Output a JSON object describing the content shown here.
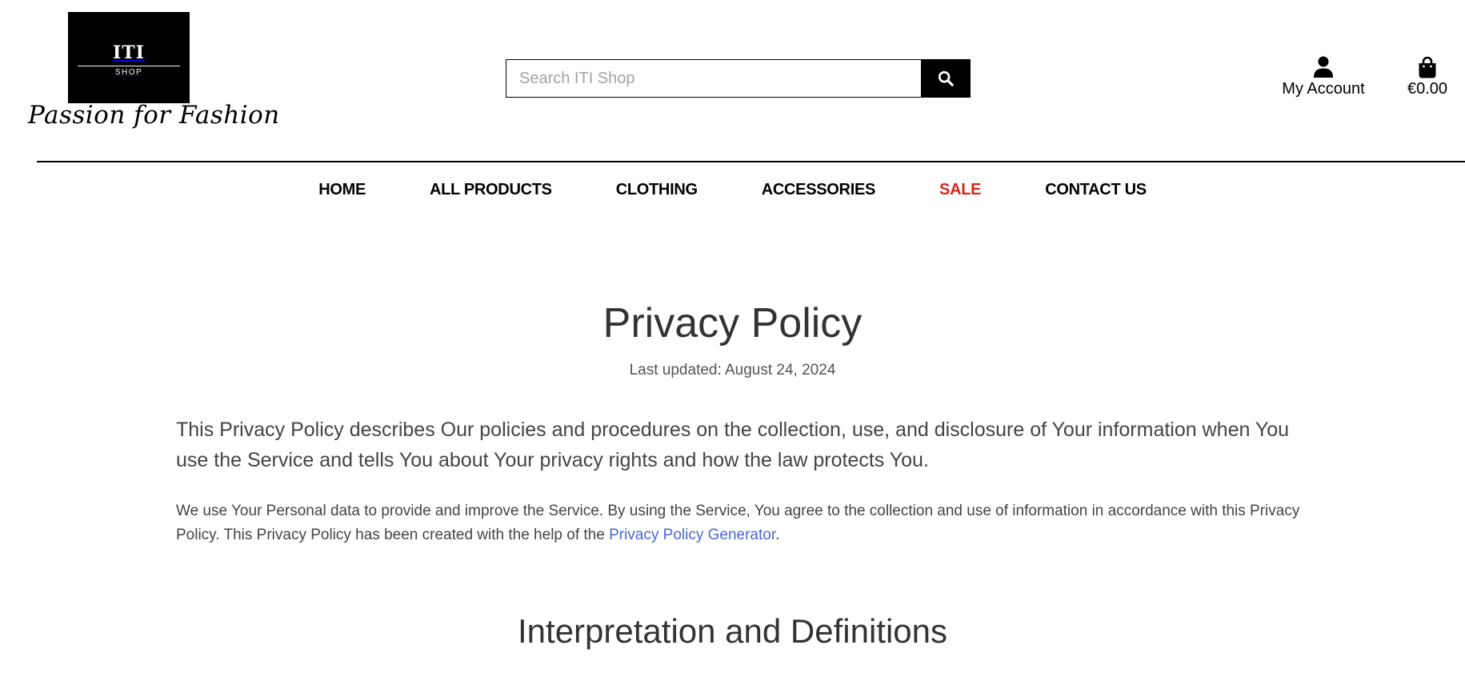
{
  "header": {
    "logo": {
      "title": "ITI",
      "subtitle": "SHOP",
      "tagline": "Passion for Fashion"
    },
    "search": {
      "placeholder": "Search ITI Shop",
      "value": ""
    },
    "account_label": "My Account",
    "cart_total": "€0.00"
  },
  "nav": {
    "items": [
      {
        "label": "HOME"
      },
      {
        "label": "ALL PRODUCTS"
      },
      {
        "label": "CLOTHING"
      },
      {
        "label": "ACCESSORIES"
      },
      {
        "label": "SALE",
        "color": "#d7261e"
      },
      {
        "label": "CONTACT US"
      }
    ]
  },
  "main": {
    "title": "Privacy Policy",
    "last_updated": "Last updated: August 24, 2024",
    "intro": "This Privacy Policy describes Our policies and procedures on the collection, use, and disclosure of Your information when You use the Service and tells You about Your privacy rights and how the law protects You.",
    "para_before_link": "We use Your Personal data to provide and improve the Service. By using the Service, You agree to the collection and use of information in accordance with this Privacy Policy. This Privacy Policy has been created with the help of the ",
    "link_text": "Privacy Policy Generator",
    "para_after_link": ".",
    "section_title": "Interpretation and Definitions"
  },
  "colors": {
    "accent_sale": "#d7261e",
    "link": "#4a67d6",
    "brand": "#000000"
  },
  "icons": {
    "search": "search-icon",
    "account": "user-icon",
    "cart": "shopping-bag-icon"
  }
}
